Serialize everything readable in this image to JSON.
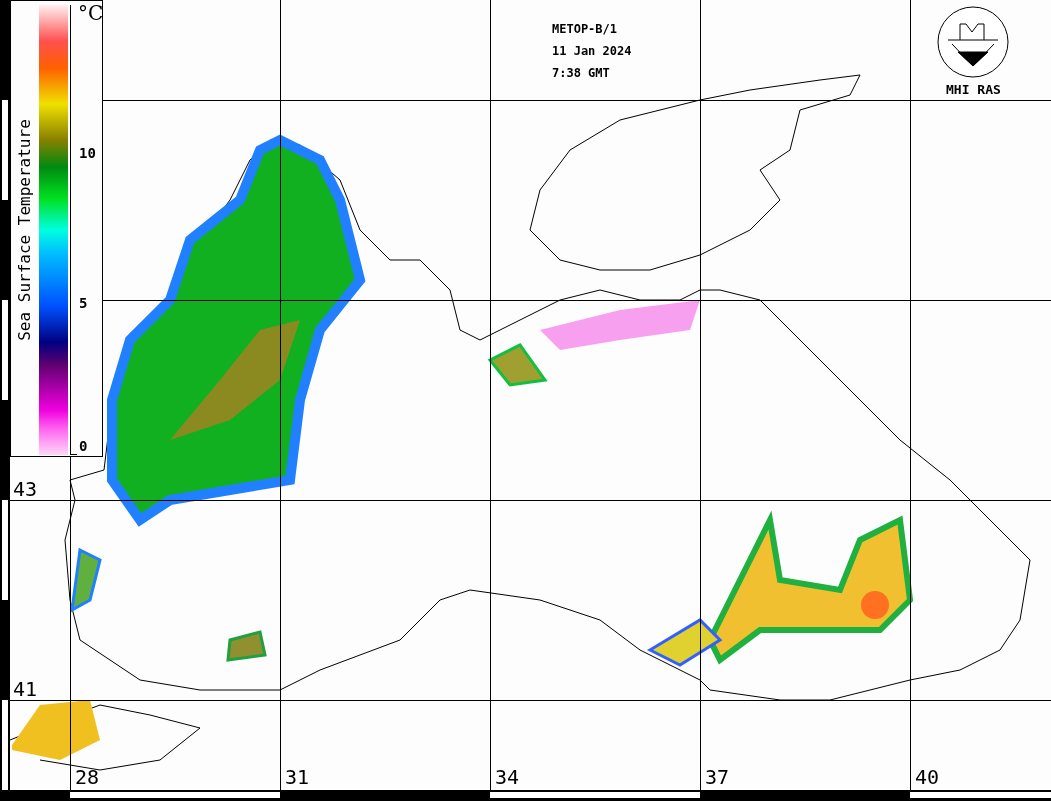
{
  "header": {
    "lines": [
      "METOP-B/1",
      "11 Jan 2024",
      "7:38 GMT"
    ]
  },
  "logo": {
    "label": "MHI RAS"
  },
  "colorbar": {
    "title": "Sea Surface Temperature",
    "unit": "°C",
    "ticks": [
      "10",
      "5",
      "0"
    ]
  },
  "latitude_labels": [
    "43",
    "41"
  ],
  "longitude_labels": [
    "28",
    "31",
    "34",
    "37",
    "40"
  ]
}
